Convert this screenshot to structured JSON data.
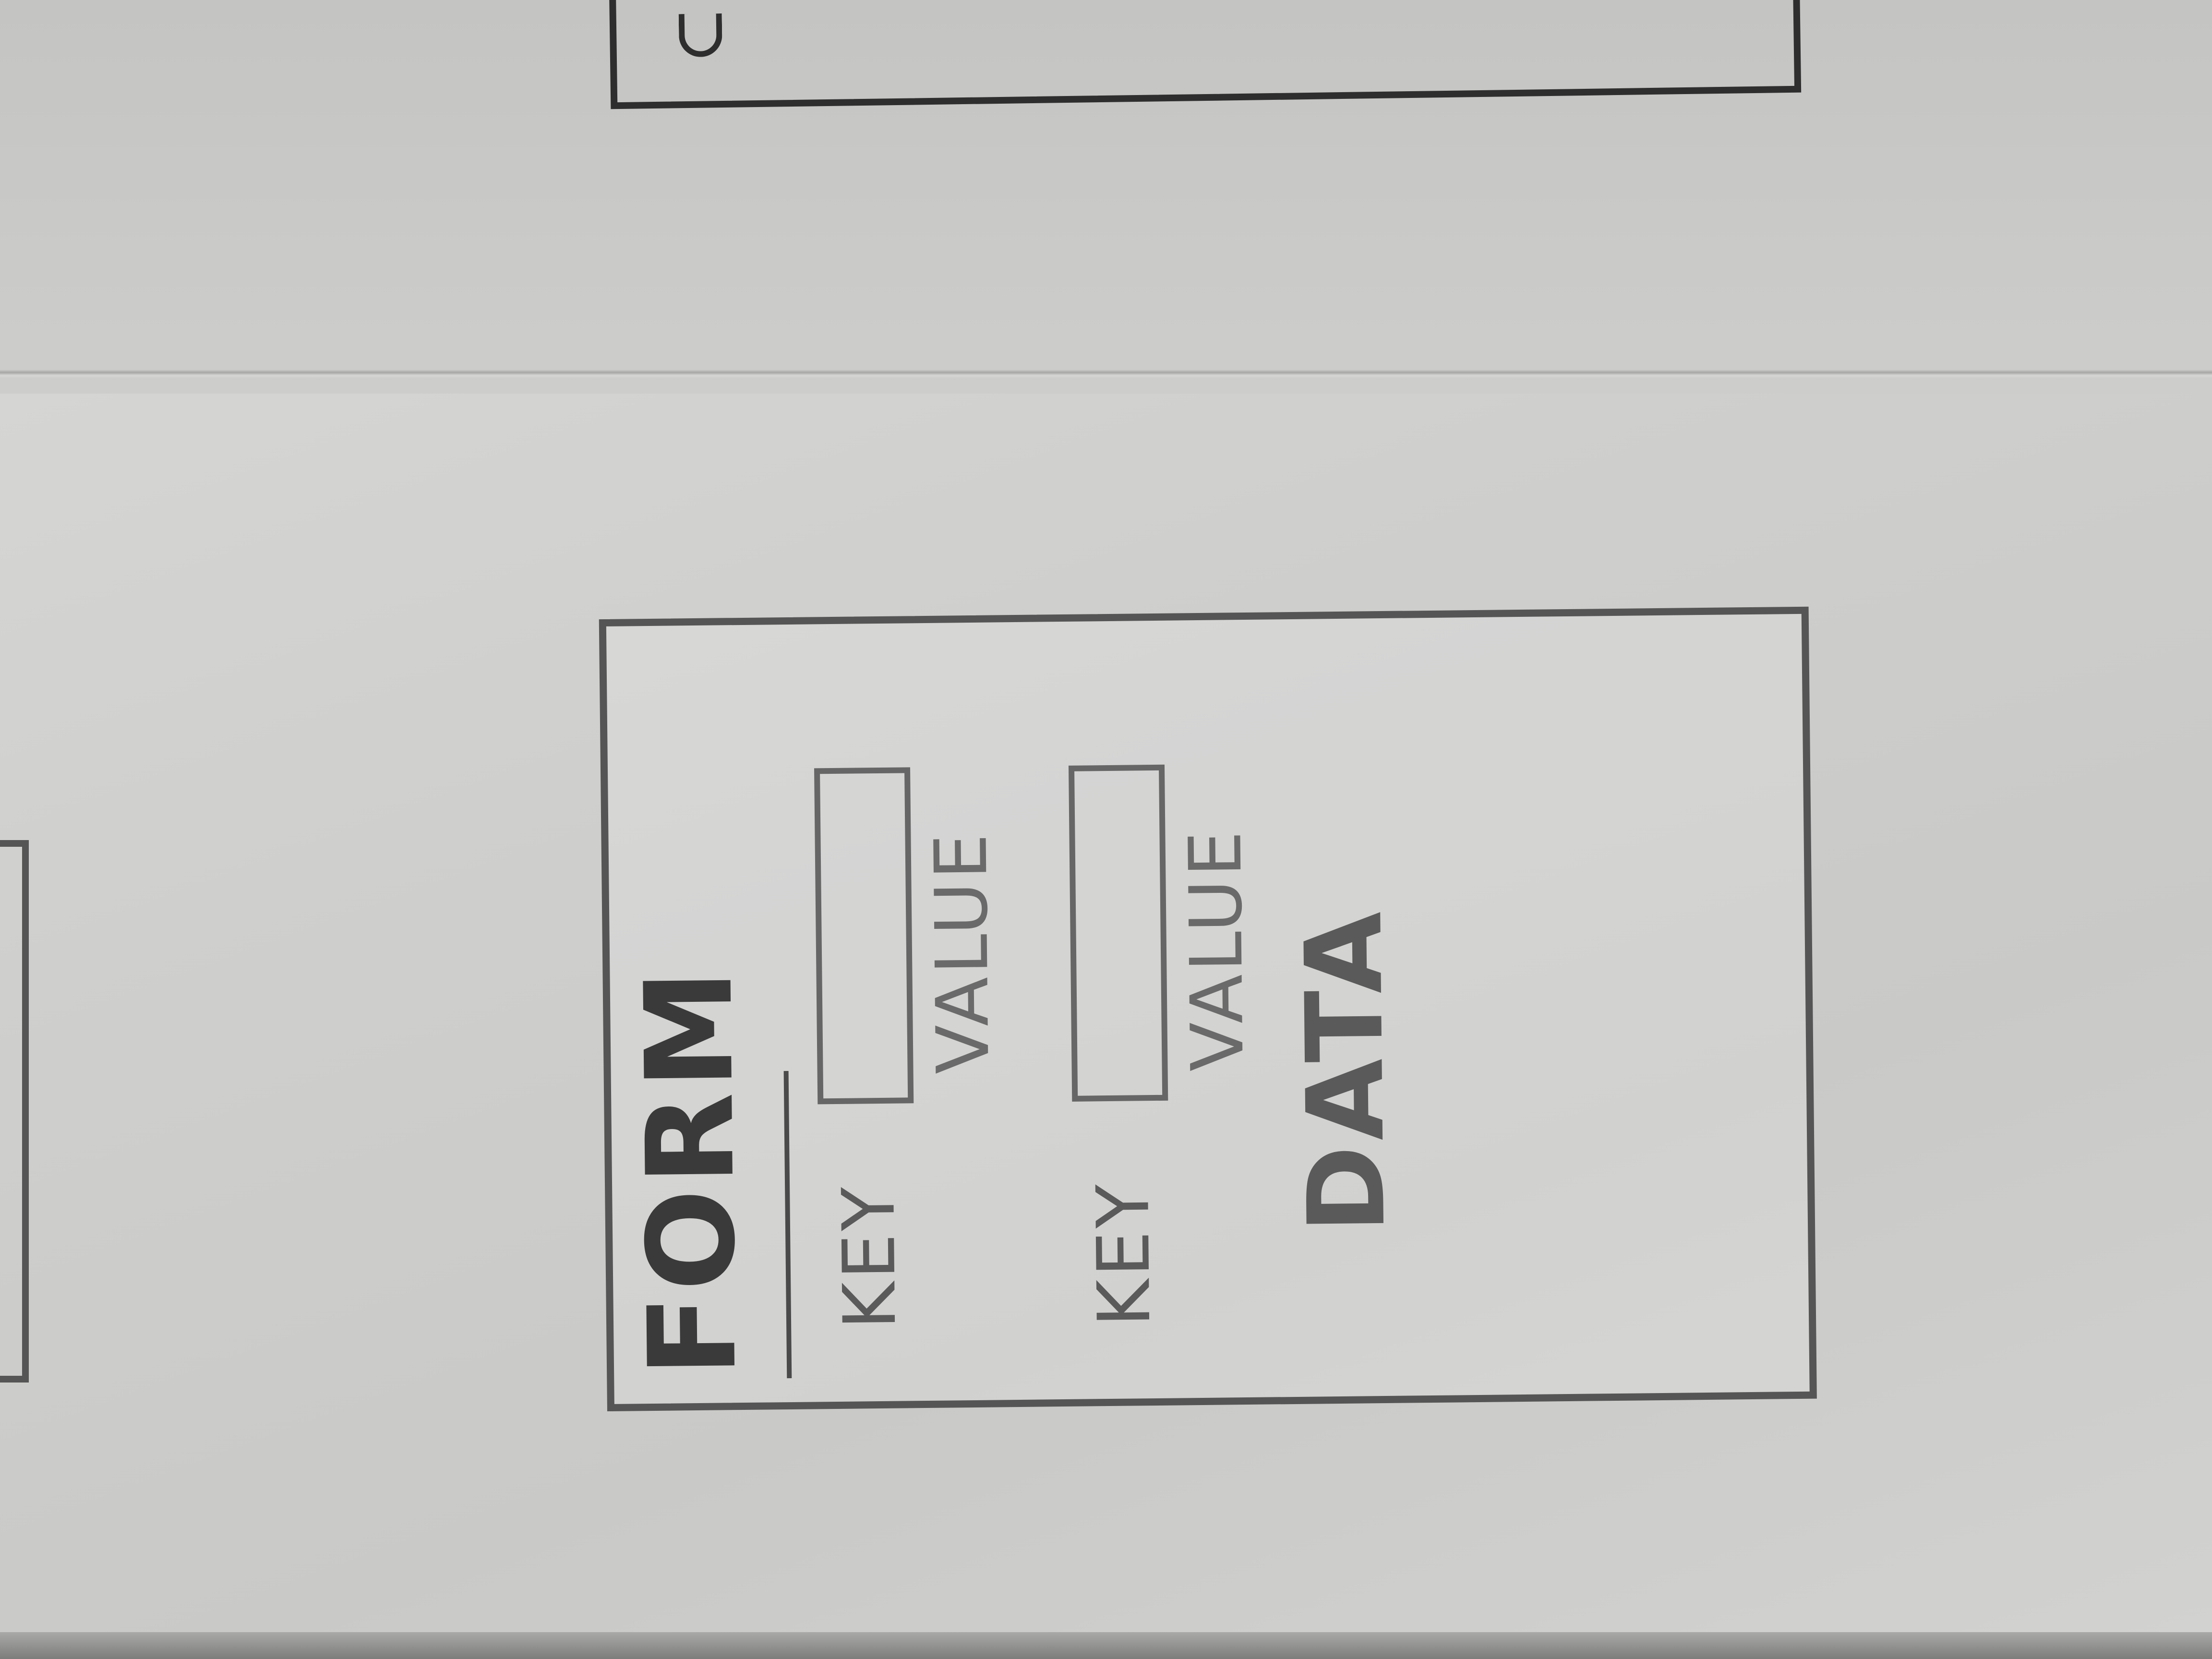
{
  "form": {
    "title": "FORM",
    "rows": [
      {
        "key_label": "KEY",
        "input_value": "",
        "value_label": "VALUE"
      },
      {
        "key_label": "KEY",
        "input_value": "",
        "value_label": "VALUE"
      }
    ],
    "data_label": "DATA"
  },
  "colors": {
    "pencil": "#4a4a4a",
    "paper": "#d2d2d0"
  }
}
